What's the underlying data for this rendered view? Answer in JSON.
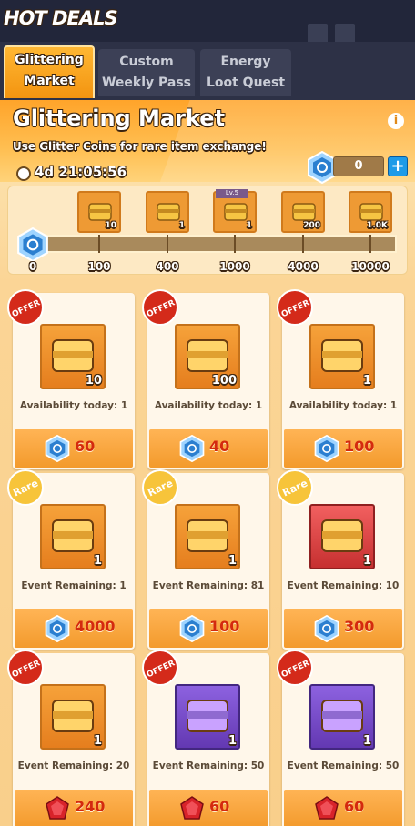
{
  "header": {
    "title": "HOT DEALS"
  },
  "tabs": [
    {
      "label1": "Glittering",
      "label2": "Market",
      "active": true
    },
    {
      "label1": "Custom",
      "label2": "Weekly Pass"
    },
    {
      "label1": "Energy",
      "label2": "Loot Quest"
    }
  ],
  "market": {
    "title": "Glittering Market",
    "subtitle": "Use Glitter Coins for rare item exchange!",
    "timer": "4d 21:05:56",
    "coins": "0",
    "info": "i",
    "plus": "+"
  },
  "track": {
    "start": "0",
    "milestones": [
      {
        "threshold": "100",
        "reward_icon": "puzzle-piece-icon",
        "count": "10"
      },
      {
        "threshold": "400",
        "reward_icon": "chest-icon",
        "count": "1"
      },
      {
        "threshold": "1000",
        "reward_icon": "lv5-chest-icon",
        "count": "1",
        "tag": "Lv.5"
      },
      {
        "threshold": "4000",
        "reward_icon": "gear-icon",
        "count": "200"
      },
      {
        "threshold": "10000",
        "reward_icon": "energy-book-icon",
        "count": "1.0K"
      }
    ]
  },
  "items": [
    {
      "badge": "OFFER",
      "icon": "red-crate-icon",
      "count": "10",
      "label": "Availability today: 1",
      "price": "60",
      "currency": "glitter-coin",
      "bg": "orange"
    },
    {
      "badge": "OFFER",
      "icon": "energy-book-icon",
      "count": "100",
      "label": "Availability today: 1",
      "price": "40",
      "currency": "glitter-coin",
      "bg": "orange"
    },
    {
      "badge": "OFFER",
      "icon": "silver-chest-icon",
      "count": "1",
      "label": "Availability today: 1",
      "price": "100",
      "currency": "glitter-coin",
      "bg": "orange"
    },
    {
      "badge": "Rare",
      "icon": "aircraft-icon",
      "count": "1",
      "label": "Event Remaining: 1",
      "price": "4000",
      "currency": "glitter-coin",
      "bg": "orange"
    },
    {
      "badge": "Rare",
      "icon": "tower-icon",
      "count": "1",
      "label": "Event Remaining: 81",
      "price": "100",
      "currency": "glitter-coin",
      "bg": "orange"
    },
    {
      "badge": "Rare",
      "icon": "emblem-icon",
      "count": "1",
      "label": "Event Remaining: 10",
      "price": "300",
      "currency": "glitter-coin",
      "bg": "red"
    },
    {
      "badge": "OFFER",
      "icon": "puzzle-piece-icon",
      "count": "1",
      "label": "Event Remaining: 20",
      "price": "240",
      "currency": "ruby",
      "bg": "orange"
    },
    {
      "badge": "OFFER",
      "icon": "purple-chest-icon",
      "count": "1",
      "label": "Event Remaining: 50",
      "price": "60",
      "currency": "ruby",
      "bg": "purple"
    },
    {
      "badge": "OFFER",
      "icon": "gold-chest-icon",
      "count": "1",
      "label": "Event Remaining: 50",
      "price": "60",
      "currency": "ruby",
      "bg": "purple"
    }
  ],
  "colors": {
    "accent": "#f39410",
    "price": "#d42a0e",
    "coin": "#2b7fd0"
  }
}
